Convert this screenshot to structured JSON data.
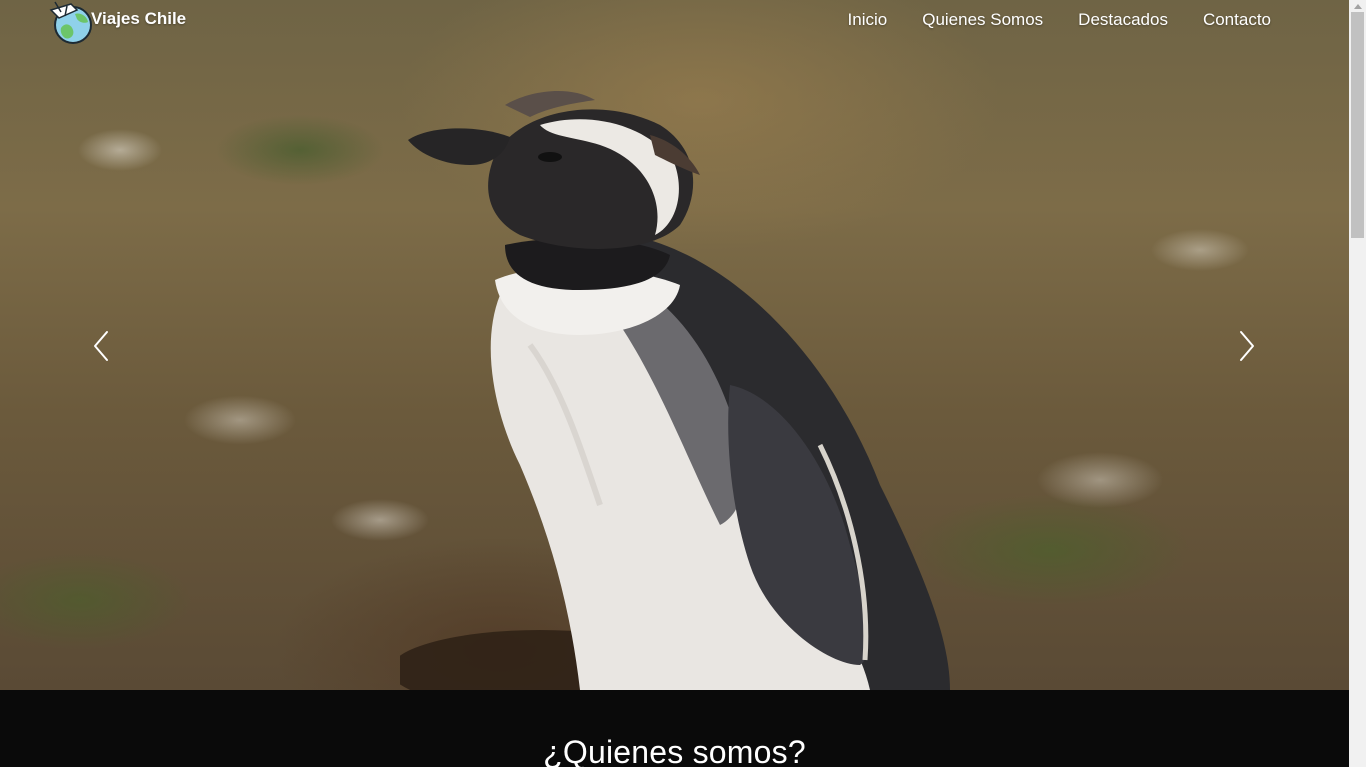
{
  "navbar": {
    "brand_label": "Viajes Chile",
    "links": [
      {
        "label": "Inicio"
      },
      {
        "label": "Quienes Somos"
      },
      {
        "label": "Destacados"
      },
      {
        "label": "Contacto"
      }
    ]
  },
  "carousel": {
    "prev_icon": "chevron-left-icon",
    "next_icon": "chevron-right-icon",
    "slide_subject": "penguin-photo"
  },
  "about": {
    "title": "¿Quienes somos?"
  },
  "colors": {
    "section_background": "#0a0a0a",
    "nav_text": "#ffffff"
  }
}
